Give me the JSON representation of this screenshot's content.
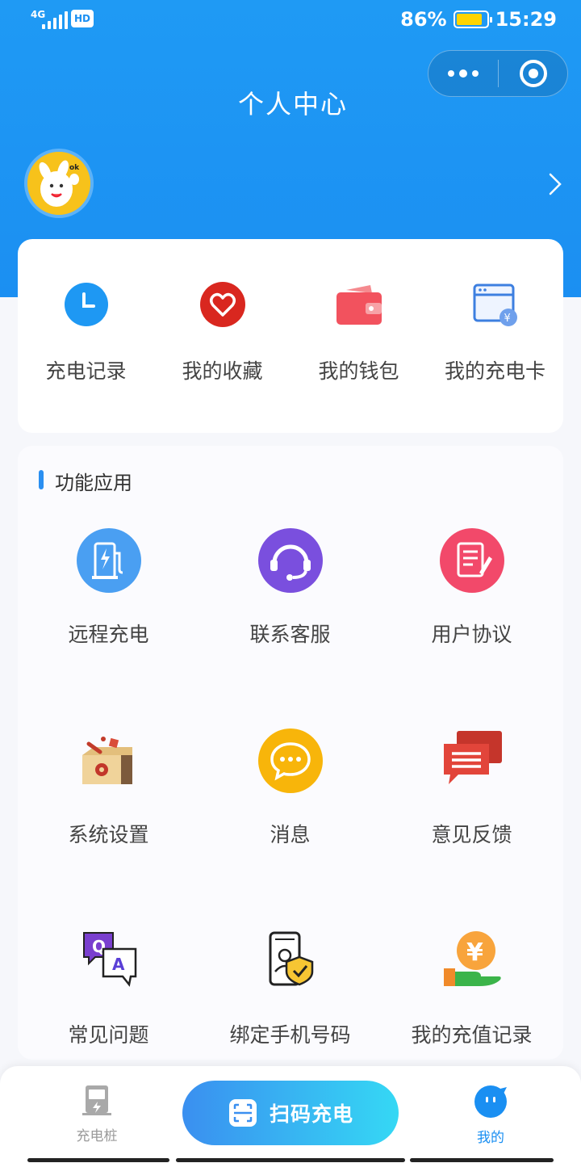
{
  "status_bar": {
    "network": "4G",
    "hd": "HD",
    "battery": "86%",
    "battery_level": 0.86,
    "time": "15:29"
  },
  "header": {
    "title": "个人中心"
  },
  "quick_actions": [
    {
      "label": "充电记录",
      "icon": "clock-icon"
    },
    {
      "label": "我的收藏",
      "icon": "heart-icon"
    },
    {
      "label": "我的钱包",
      "icon": "wallet-icon"
    },
    {
      "label": "我的充电卡",
      "icon": "charging-card-icon"
    }
  ],
  "functions": {
    "title": "功能应用",
    "items": [
      {
        "label": "远程充电",
        "icon": "charging-pile-icon"
      },
      {
        "label": "联系客服",
        "icon": "headset-icon"
      },
      {
        "label": "用户协议",
        "icon": "document-icon"
      },
      {
        "label": "系统设置",
        "icon": "toolbox-icon"
      },
      {
        "label": "消息",
        "icon": "chat-bubble-icon"
      },
      {
        "label": "意见反馈",
        "icon": "feedback-icon"
      },
      {
        "label": "常见问题",
        "icon": "qa-icon"
      },
      {
        "label": "绑定手机号码",
        "icon": "phone-shield-icon"
      },
      {
        "label": "我的充值记录",
        "icon": "yuan-coin-icon"
      }
    ]
  },
  "tabbar": {
    "left_label": "充电桩",
    "center_label": "扫码充电",
    "right_label": "我的"
  },
  "colors": {
    "primary": "#1b8ff2",
    "active_tab": "#1a8ff2",
    "inactive_tab": "#9a9a9a"
  }
}
